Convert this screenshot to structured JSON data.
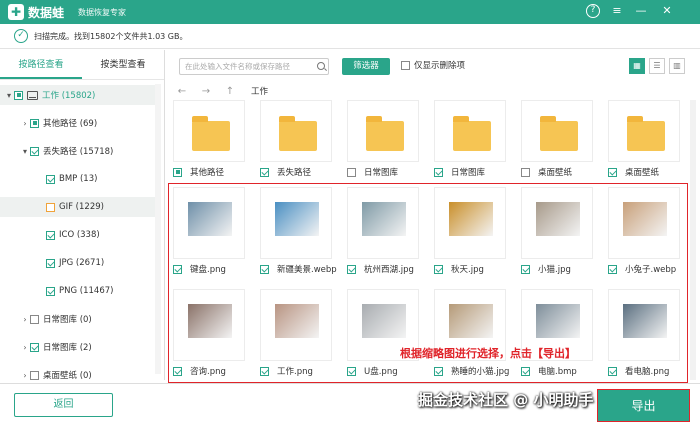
{
  "app": {
    "brand": "数据蛙",
    "subtitle": "数据恢复专家",
    "logo_glyph": "✚"
  },
  "window_controls": [
    {
      "name": "help-icon",
      "glyph": "?"
    },
    {
      "name": "menu-icon",
      "glyph": "≡"
    },
    {
      "name": "minimize-icon",
      "glyph": "—"
    },
    {
      "name": "close-icon",
      "glyph": "✕"
    }
  ],
  "status": {
    "text": "扫描完成。找到15802个文件共1.03 GB。"
  },
  "tabs": [
    {
      "label": "按路径查看",
      "active": true
    },
    {
      "label": "按类型查看",
      "active": false
    }
  ],
  "tree": [
    {
      "label": "工作 (15802)",
      "state": "part"
    },
    {
      "label": "其他路径 (69)",
      "state": "part"
    },
    {
      "label": "丢失路径 (15718)",
      "state": "checked"
    },
    {
      "label": "BMP (13)",
      "state": "checked"
    },
    {
      "label": "GIF (1229)",
      "state": "orange"
    },
    {
      "label": "ICO (338)",
      "state": "checked"
    },
    {
      "label": "JPG (2671)",
      "state": "checked"
    },
    {
      "label": "PNG (11467)",
      "state": "checked"
    },
    {
      "label": "日常图库 (0)",
      "state": "empty"
    },
    {
      "label": "日常图库 (2)",
      "state": "checked"
    },
    {
      "label": "桌面壁纸 (0)",
      "state": "empty"
    }
  ],
  "toolbar": {
    "search_placeholder": "在此处输入文件名称或保存路径",
    "filter_label": "筛选器",
    "only_deleted_label": "仅显示删除项"
  },
  "view_buttons": [
    {
      "glyph": "▦",
      "active": true
    },
    {
      "glyph": "☰",
      "active": false
    },
    {
      "glyph": "▥",
      "active": false
    }
  ],
  "nav": {
    "back": "←",
    "forward": "→",
    "up": "↑",
    "path": "工作"
  },
  "folders": [
    {
      "label": "其他路径",
      "state": "part"
    },
    {
      "label": "丢失路径",
      "state": "checked"
    },
    {
      "label": "日常图库",
      "state": "empty"
    },
    {
      "label": "日常图库",
      "state": "checked"
    },
    {
      "label": "桌面壁纸",
      "state": "empty"
    },
    {
      "label": "桌面壁纸",
      "state": "checked"
    }
  ],
  "images_row1": [
    {
      "label": "键盘.png",
      "color": "#6e8fa8"
    },
    {
      "label": "新疆美景.webp",
      "color": "#4a8fc2"
    },
    {
      "label": "杭州西湖.jpg",
      "color": "#7f9aa6"
    },
    {
      "label": "秋天.jpg",
      "color": "#c98f2a"
    },
    {
      "label": "小猫.jpg",
      "color": "#a79a8a"
    },
    {
      "label": "小兔子.webp",
      "color": "#c8a07a"
    }
  ],
  "images_row2": [
    {
      "label": "咨询.png",
      "color": "#8a7268"
    },
    {
      "label": "工作.png",
      "color": "#b89482"
    },
    {
      "label": "U盘.png",
      "color": "#a8acb0"
    },
    {
      "label": "熟睡的小猫.jpg",
      "color": "#b59a78"
    },
    {
      "label": "电脑.bmp",
      "color": "#7e8e9a"
    },
    {
      "label": "看电脑.png",
      "color": "#5a6f80"
    }
  ],
  "hint": "根据缩略图进行选择，点击【导出】",
  "buttons": {
    "back": "返回",
    "export": "导出"
  },
  "watermark": "掘金技术社区 @ 小明助手"
}
